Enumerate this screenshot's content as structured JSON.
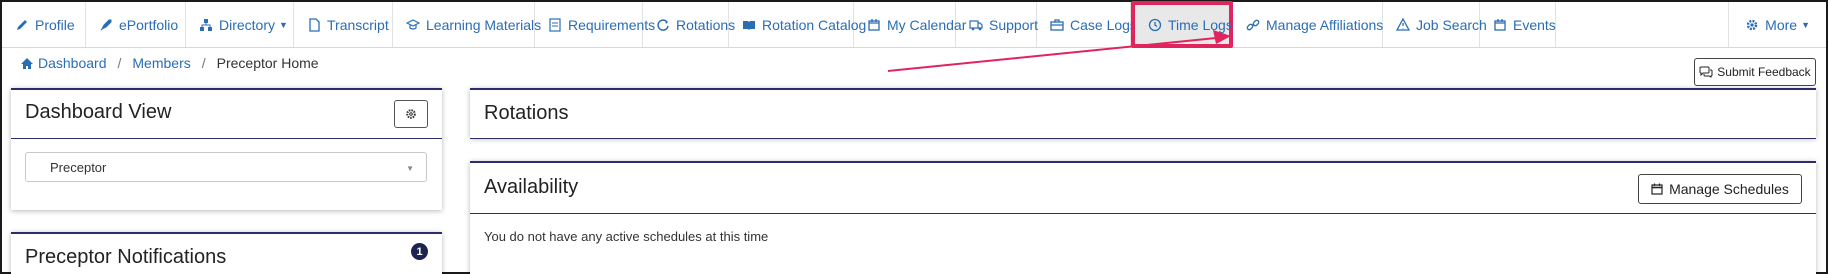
{
  "nav": {
    "items": [
      {
        "label": "Profile",
        "icon": "pencil-icon"
      },
      {
        "label": "ePortfolio",
        "icon": "rocket-icon"
      },
      {
        "label": "Directory",
        "icon": "sitemap-icon",
        "dropdown": true
      },
      {
        "label": "Transcript",
        "icon": "document-icon"
      },
      {
        "label": "Learning Materials",
        "icon": "graduation-cap-icon"
      },
      {
        "label": "Requirements",
        "icon": "list-box-icon"
      },
      {
        "label": "Rotations",
        "icon": "refresh-icon"
      },
      {
        "label": "Rotation Catalog",
        "icon": "book-open-icon"
      },
      {
        "label": "My Calendar",
        "icon": "calendar-icon"
      },
      {
        "label": "Support",
        "icon": "ambulance-icon"
      },
      {
        "label": "Case Logs",
        "icon": "briefcase-icon"
      },
      {
        "label": "Time Logs",
        "icon": "clock-icon"
      },
      {
        "label": "Manage Affiliations",
        "icon": "link-icon"
      },
      {
        "label": "Job Search",
        "icon": "alert-triangle-icon"
      },
      {
        "label": "Events",
        "icon": "calendar-icon"
      }
    ],
    "more_label": "More",
    "highlight_color": "#e0245e",
    "link_color": "#2a6db5"
  },
  "breadcrumb": {
    "dashboard": "Dashboard",
    "members": "Members",
    "current": "Preceptor Home",
    "separator": "/"
  },
  "feedback": {
    "label": "Submit Feedback"
  },
  "dashboard_view": {
    "title": "Dashboard View",
    "selected": "Preceptor"
  },
  "notifications": {
    "title": "Preceptor Notifications",
    "count": "1"
  },
  "rotations": {
    "title": "Rotations"
  },
  "availability": {
    "title": "Availability",
    "manage_label": "Manage Schedules",
    "empty_text": "You do not have any active schedules at this time"
  },
  "colors": {
    "panel_accent": "#2c2e6b",
    "badge": "#1d2450",
    "arrow": "#e0245e"
  }
}
